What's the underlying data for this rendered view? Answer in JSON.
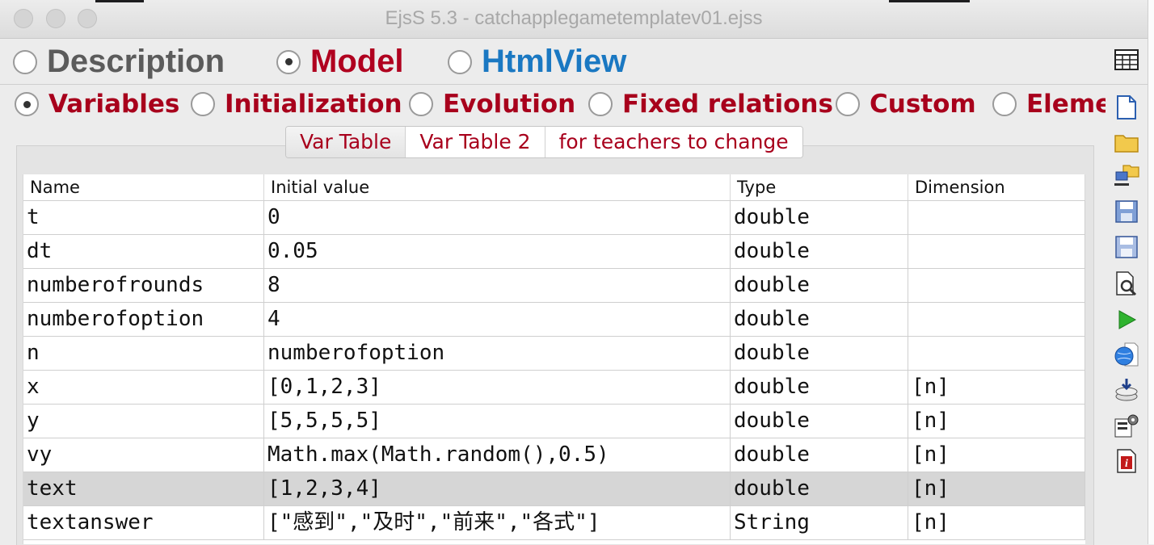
{
  "window": {
    "title": "EjsS 5.3 - catchapplegametemplatev01.ejss"
  },
  "main_tabs": [
    {
      "label": "Description",
      "selected": false,
      "color": "#5b5b5b"
    },
    {
      "label": "Model",
      "selected": true,
      "color": "#b0001f"
    },
    {
      "label": "HtmlView",
      "selected": false,
      "color": "#1a78c2"
    }
  ],
  "sub_tabs": [
    {
      "label": "Variables",
      "selected": true
    },
    {
      "label": "Initialization",
      "selected": false
    },
    {
      "label": "Evolution",
      "selected": false
    },
    {
      "label": "Fixed relations",
      "selected": false
    },
    {
      "label": "Custom",
      "selected": false
    },
    {
      "label": "Eleme",
      "selected": false
    }
  ],
  "var_tabs": [
    {
      "label": "Var Table",
      "active": true
    },
    {
      "label": "Var Table 2",
      "active": false
    },
    {
      "label": "for teachers to change",
      "active": false
    }
  ],
  "table": {
    "headers": [
      "Name",
      "Initial value",
      "Type",
      "Dimension"
    ],
    "rows": [
      {
        "name": "t",
        "value": "0",
        "type": "double",
        "dim": "",
        "selected": false
      },
      {
        "name": "dt",
        "value": "0.05",
        "type": "double",
        "dim": "",
        "selected": false
      },
      {
        "name": "numberofrounds",
        "value": "8",
        "type": "double",
        "dim": "",
        "selected": false
      },
      {
        "name": "numberofoption",
        "value": "4",
        "type": "double",
        "dim": "",
        "selected": false
      },
      {
        "name": "n",
        "value": "numberofoption",
        "type": "double",
        "dim": "",
        "selected": false
      },
      {
        "name": "x",
        "value": "[0,1,2,3]",
        "type": "double",
        "dim": "[n]",
        "selected": false
      },
      {
        "name": "y",
        "value": "[5,5,5,5]",
        "type": "double",
        "dim": "[n]",
        "selected": false
      },
      {
        "name": "vy",
        "value": "Math.max(Math.random(),0.5)",
        "type": "double",
        "dim": "[n]",
        "selected": false
      },
      {
        "name": "text",
        "value": "[1,2,3,4]",
        "type": "double",
        "dim": "[n]",
        "selected": true
      },
      {
        "name": "textanswer",
        "value": "[\"感到\",\"及时\",\"前来\",\"各式\"]",
        "type": "String",
        "dim": "[n]",
        "selected": false
      }
    ]
  },
  "toolbar": [
    "new-file-icon",
    "open-folder-icon",
    "network-folder-icon",
    "save-icon",
    "save-as-icon",
    "search-icon",
    "run-icon",
    "web-icon",
    "download-icon",
    "options-icon",
    "info-icon"
  ],
  "colors": {
    "accent_red": "#a8001c",
    "html_blue": "#1a78c2",
    "selected_row": "#d6d6d6"
  }
}
